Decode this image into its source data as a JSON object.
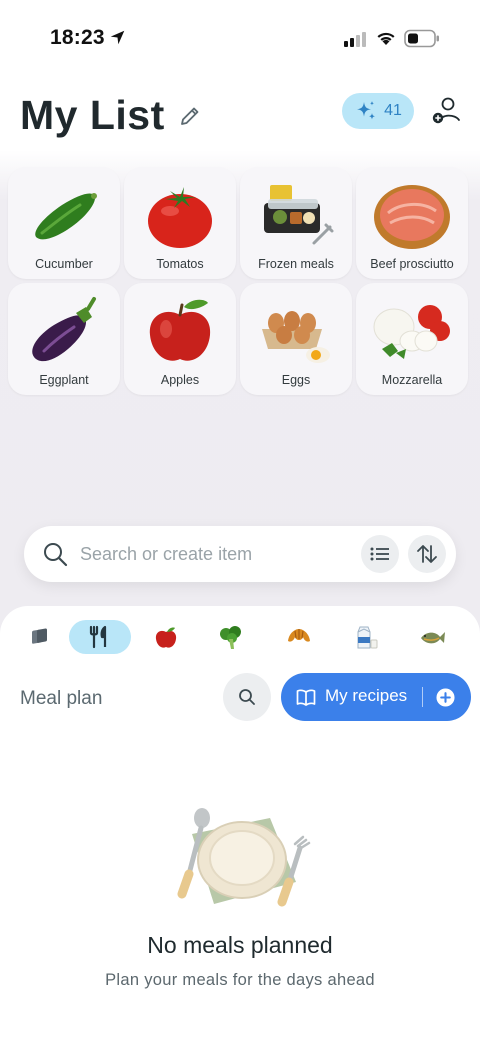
{
  "status_bar": {
    "time": "18:23"
  },
  "header": {
    "title": "My List",
    "sparkle_count": "41"
  },
  "items": [
    {
      "label": "Cucumber",
      "icon": "cucumber-icon"
    },
    {
      "label": "Tomatos",
      "icon": "tomato-icon"
    },
    {
      "label": "Frozen meals",
      "icon": "frozen-meal-icon"
    },
    {
      "label": "Beef prosciutto",
      "icon": "prosciutto-icon"
    },
    {
      "label": "Eggplant",
      "icon": "eggplant-icon"
    },
    {
      "label": "Apples",
      "icon": "apple-icon"
    },
    {
      "label": "Eggs",
      "icon": "eggs-icon"
    },
    {
      "label": "Mozzarella",
      "icon": "mozzarella-icon"
    }
  ],
  "search": {
    "placeholder": "Search or create item"
  },
  "category_tabs": [
    {
      "icon": "layers-icon",
      "active": false
    },
    {
      "icon": "fork-knife-icon",
      "active": true
    },
    {
      "icon": "apple-icon",
      "active": false
    },
    {
      "icon": "broccoli-icon",
      "active": false
    },
    {
      "icon": "croissant-icon",
      "active": false
    },
    {
      "icon": "milk-icon",
      "active": false
    },
    {
      "icon": "fish-icon",
      "active": false
    }
  ],
  "meal_plan": {
    "label": "Meal plan",
    "recipes_label": "My recipes",
    "empty_title": "No meals planned",
    "empty_subtitle": "Plan your meals for the days ahead"
  },
  "colors": {
    "accent": "#3b80ea",
    "badge": "#b9e6f8",
    "background": "#eeecf1"
  }
}
